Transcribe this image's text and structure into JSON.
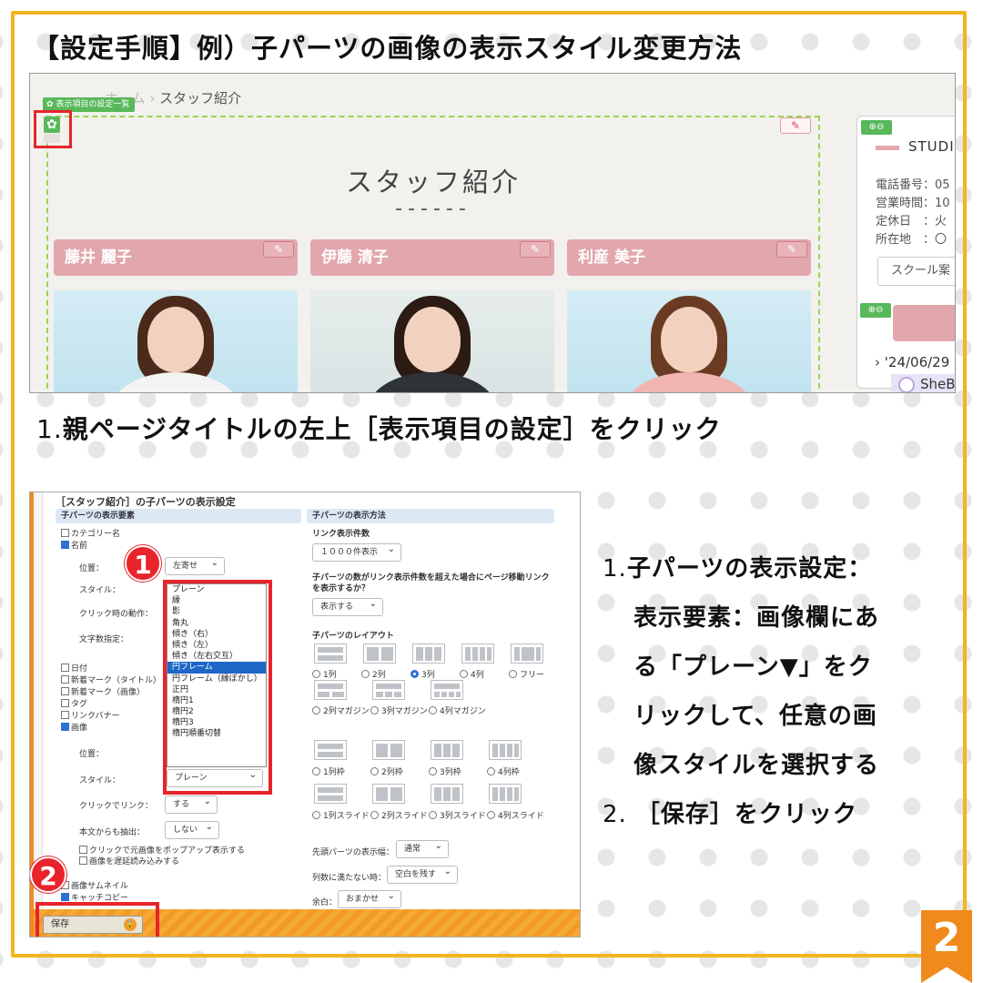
{
  "headline": "【設定手順】例）子パーツの画像の表示スタイル変更方法",
  "caption1": {
    "num": "1.",
    "text": "親ページタイトルの左上［表示項目の設定］をクリック"
  },
  "shot1": {
    "breadcrumb_faded": "ホーム ›",
    "breadcrumb": "スタッフ紹介",
    "tag_label": "表示項目の設定一覧",
    "title": "スタッフ紹介",
    "title_dash": "------",
    "staff": [
      "藤井 麗子",
      "伊藤 清子",
      "利産 美子"
    ],
    "side": {
      "studio": "STUDI",
      "phone": "電話番号：05",
      "hours": "営業時間：10",
      "closed": "定休日　：火",
      "address": "所在地　：〇",
      "button": "スクール案",
      "date": "'24/06/29",
      "she": "SheB"
    }
  },
  "shot2": {
    "title": "［スタッフ紹介］の子パーツの表示設定",
    "left_head": "子パーツの表示要素",
    "right_head": "子パーツの表示方法",
    "category": "カテゴリー名",
    "name": "名前",
    "pos_label": "位置：",
    "pos_value": "左寄せ",
    "style_label": "スタイル：",
    "click_label": "クリック時の動作：",
    "chars_label": "文字数指定：",
    "date": "日付",
    "new_title": "新着マーク（タイトル）",
    "new_image": "新着マーク（画像）",
    "tag": "タグ",
    "link_banner": "リンクバナー",
    "image": "画像",
    "img_pos_label": "位置：",
    "img_style_label": "スタイル：",
    "img_style_value": "プレーン",
    "img_click_label": "クリックでリンク：",
    "img_click_value": "する",
    "extract_label": "本文からも抽出：",
    "extract_value": "しない",
    "popup": "クリックで元画像をポップアップ表示する",
    "lazy": "画像を遅延読み込みする",
    "thumb": "画像サムネイル",
    "catch": "キャッチコピー",
    "dropdown": [
      "プレーン",
      "縁",
      "影",
      "角丸",
      "傾き（右）",
      "傾き（左）",
      "傾き（左右交互）",
      "円フレーム",
      "円フレーム（縁ぼかし）",
      "正円",
      "楕円1",
      "楕円2",
      "楕円3",
      "楕円順番切替"
    ],
    "dropdown_selected": "円フレーム",
    "link_count_label": "リンク表示件数",
    "link_count_value": "１０００件表示",
    "paging_question": "子パーツの数がリンク表示件数を超えた場合にページ移動リンクを表示するか？",
    "paging_value": "表示する",
    "layout_label": "子パーツのレイアウト",
    "layout_row1": [
      "1列",
      "2列",
      "3列",
      "4列",
      "フリー"
    ],
    "layout_row2": [
      "2列マガジン",
      "3列マガジン",
      "4列マガジン"
    ],
    "layout_row3": [
      "1列枠",
      "2列枠",
      "3列枠",
      "4列枠"
    ],
    "layout_row4": [
      "1列スライド",
      "2列スライド",
      "3列スライド",
      "4列スライド"
    ],
    "lead_width_label": "先頭パーツの表示幅：",
    "lead_width_value": "通常",
    "short_label": "列数に満たない時：",
    "short_value": "空白を残す",
    "margin_label": "余白：",
    "margin_value": "おまかせ",
    "save": "保存",
    "badge1": "1",
    "badge2": "2"
  },
  "steps": {
    "s1_num": "1.",
    "s1_l1": "子パーツの表示設定：",
    "s1_l2": "表示要素：画像欄にあ",
    "s1_l3": "る「プレーン▼」をク",
    "s1_l4": "リックして、任意の画",
    "s1_l5": "像スタイルを選択する",
    "s2_num": "2.",
    "s2_text": "［保存］をクリック"
  },
  "page_number": "2",
  "colors": {
    "frame": "#f3b51c",
    "accent_red": "#e8232b",
    "badge_orange": "#f08a1c",
    "card_pink": "#e2a6ad",
    "green": "#58b85a"
  }
}
